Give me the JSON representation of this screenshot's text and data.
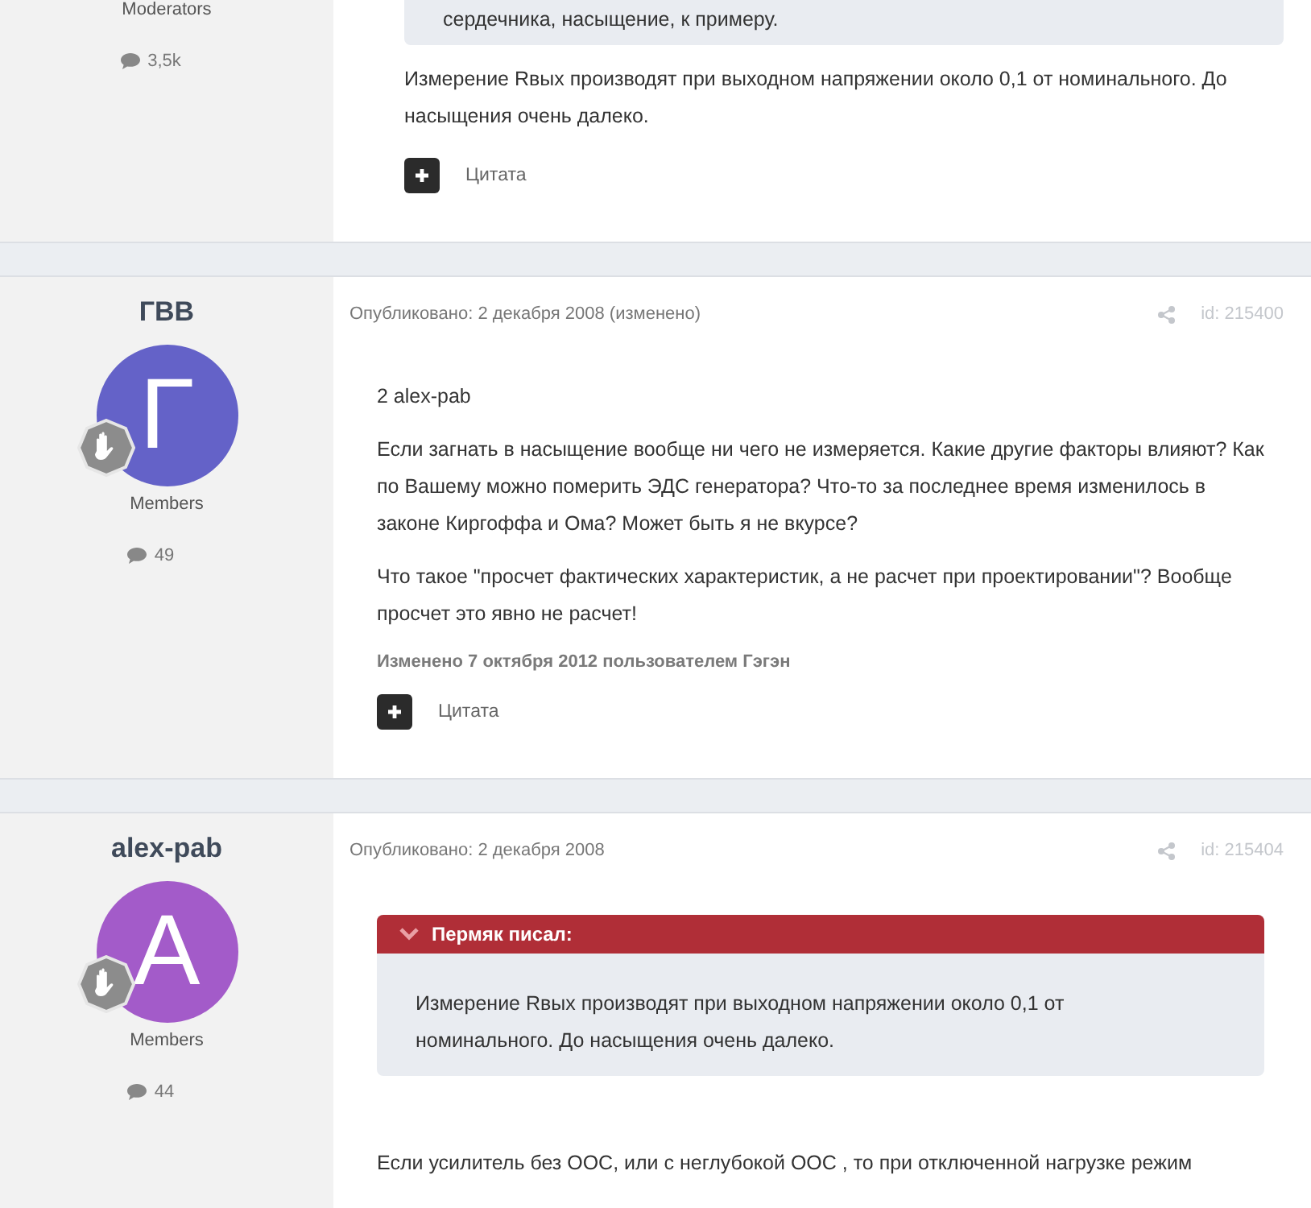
{
  "posts": [
    {
      "role": "Moderators",
      "post_count": "3,5k",
      "quote": {
        "text": "сердечника, насыщение, к примеру."
      },
      "paragraphs": [
        "Измерение Rвых производят при выходном напряжении около 0,1 от номинального. До насыщения очень далеко."
      ],
      "action": "Цитата"
    },
    {
      "author": "ГВВ",
      "avatar": {
        "letter": "Г",
        "color": "#6462c8"
      },
      "role": "Members",
      "post_count": "49",
      "published": "Опубликовано: 2 декабря 2008 (изменено)",
      "post_id": "id: 215400",
      "paragraphs": [
        "2 alex-pab",
        "Если загнать в насыщение вообще ни чего не измеряется. Какие другие факторы влияют? Как по Вашему можно померить ЭДС генератора? Что-то за последнее время изменилось в законе Киргоффа и Ома? Может быть я не вкурсе?",
        "Что такое \"просчет фактических характеристик, а не расчет при проектировании\"? Вообще просчет это явно не расчет!"
      ],
      "edited_note": "Изменено 7 октября 2012 пользователем Гэгэн",
      "action": "Цитата"
    },
    {
      "author": "alex-pab",
      "avatar": {
        "letter": "A",
        "color": "#a35bc9"
      },
      "role": "Members",
      "post_count": "44",
      "published": "Опубликовано: 2 декабря 2008",
      "post_id": "id: 215404",
      "quote": {
        "title": "Пермяк писал:",
        "text": "Измерение Rвых производят при выходном напряжении около 0,1 от номинального. До насыщения очень далеко."
      },
      "paragraphs": [
        "Если усилитель без ООС, или с неглубокой ООС , то при отключенной нагрузке режим"
      ]
    }
  ]
}
